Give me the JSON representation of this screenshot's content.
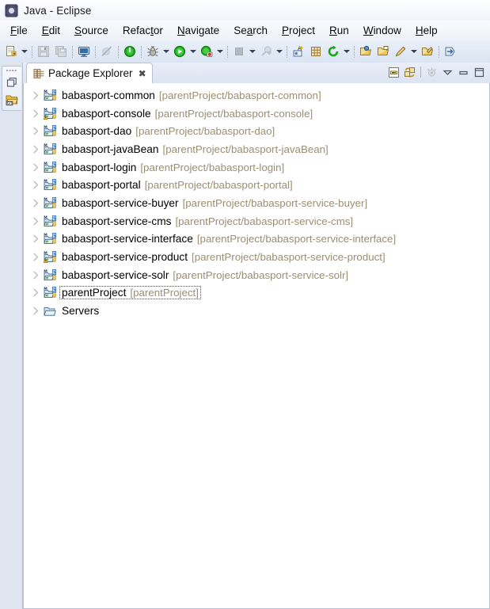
{
  "window": {
    "title": "Java - Eclipse",
    "icon": "eclipse-icon"
  },
  "menubar": {
    "items": [
      {
        "label": "File",
        "mnemonic": "F"
      },
      {
        "label": "Edit",
        "mnemonic": "E"
      },
      {
        "label": "Source",
        "mnemonic": "S"
      },
      {
        "label": "Refactor",
        "mnemonic": "t"
      },
      {
        "label": "Navigate",
        "mnemonic": "N"
      },
      {
        "label": "Search",
        "mnemonic": "a"
      },
      {
        "label": "Project",
        "mnemonic": "P"
      },
      {
        "label": "Run",
        "mnemonic": "R"
      },
      {
        "label": "Window",
        "mnemonic": "W"
      },
      {
        "label": "Help",
        "mnemonic": "H"
      }
    ]
  },
  "toolbar": {
    "items": [
      {
        "name": "new-wizard-button",
        "icon": "new-file-icon",
        "enabled": true,
        "dropdown": true
      },
      {
        "separator": true
      },
      {
        "name": "save-button",
        "icon": "save-icon",
        "enabled": false,
        "dropdown": false
      },
      {
        "name": "save-all-button",
        "icon": "save-all-icon",
        "enabled": false,
        "dropdown": false
      },
      {
        "separator": true
      },
      {
        "name": "open-console-button",
        "icon": "console-icon",
        "enabled": true,
        "dropdown": false
      },
      {
        "separator": true
      },
      {
        "name": "skip-breakpoints-button",
        "icon": "skip-breakpoints-icon",
        "enabled": false,
        "dropdown": false
      },
      {
        "separator": true
      },
      {
        "name": "run-server-button",
        "icon": "server-start-icon",
        "enabled": true,
        "dropdown": false
      },
      {
        "separator": true
      },
      {
        "name": "debug-button",
        "icon": "debug-bug-icon",
        "enabled": true,
        "dropdown": true
      },
      {
        "name": "run-button",
        "icon": "run-play-icon",
        "enabled": true,
        "dropdown": true
      },
      {
        "name": "coverage-button",
        "icon": "coverage-icon",
        "enabled": true,
        "dropdown": true
      },
      {
        "separator": true
      },
      {
        "name": "stop-button",
        "icon": "stop-square-icon",
        "enabled": false,
        "dropdown": true
      },
      {
        "name": "external-tools-button",
        "icon": "external-tools-icon",
        "enabled": false,
        "dropdown": true
      },
      {
        "separator": true
      },
      {
        "name": "new-java-class-button",
        "icon": "new-class-icon",
        "enabled": true,
        "dropdown": false
      },
      {
        "name": "new-java-package-button",
        "icon": "new-package-icon",
        "enabled": true,
        "dropdown": false
      },
      {
        "name": "refresh-button",
        "icon": "refresh-icon",
        "enabled": true,
        "dropdown": true
      },
      {
        "separator": true
      },
      {
        "name": "open-type-button",
        "icon": "open-type-icon",
        "enabled": true,
        "dropdown": false
      },
      {
        "name": "open-task-button",
        "icon": "open-task-icon",
        "enabled": true,
        "dropdown": false
      },
      {
        "name": "search-button",
        "icon": "search-pen-icon",
        "enabled": true,
        "dropdown": true
      },
      {
        "name": "last-edit-button",
        "icon": "last-edit-icon",
        "enabled": true,
        "dropdown": false
      },
      {
        "separator": true
      },
      {
        "name": "next-annotation-button",
        "icon": "next-annotation-icon",
        "enabled": true,
        "dropdown": false
      }
    ]
  },
  "fastview": {
    "buttons": [
      {
        "name": "restore-view-button",
        "icon": "restore-icon"
      },
      {
        "name": "git-repositories-button",
        "icon": "git-repositories-icon"
      }
    ]
  },
  "view": {
    "tab": {
      "label": "Package Explorer",
      "icon": "package-explorer-icon",
      "close": "✖"
    },
    "tools": [
      {
        "name": "collapse-all-button",
        "icon": "collapse-all-icon",
        "enabled": true
      },
      {
        "name": "link-with-editor-button",
        "icon": "link-editor-icon",
        "enabled": true
      },
      {
        "name": "focus-on-active-task-button",
        "icon": "focus-task-icon",
        "enabled": false
      },
      {
        "name": "view-menu-button",
        "icon": "chevron-down-icon",
        "enabled": true
      },
      {
        "name": "minimize-view-button",
        "icon": "minimize-icon",
        "enabled": true
      },
      {
        "name": "maximize-view-button",
        "icon": "maximize-icon",
        "enabled": true
      }
    ]
  },
  "tree": {
    "items": [
      {
        "name": "babasport-common",
        "path": "[parentProject/babasport-common]",
        "icon": "maven-java-project-icon",
        "expanded": false,
        "focused": false
      },
      {
        "name": "babasport-console",
        "path": "[parentProject/babasport-console]",
        "icon": "maven-java-project-warning-icon",
        "expanded": false,
        "focused": false
      },
      {
        "name": "babasport-dao",
        "path": "[parentProject/babasport-dao]",
        "icon": "maven-java-project-icon",
        "expanded": false,
        "focused": false
      },
      {
        "name": "babasport-javaBean",
        "path": "[parentProject/babasport-javaBean]",
        "icon": "maven-java-project-icon",
        "expanded": false,
        "focused": false
      },
      {
        "name": "babasport-login",
        "path": "[parentProject/babasport-login]",
        "icon": "maven-java-project-icon",
        "expanded": false,
        "focused": false
      },
      {
        "name": "babasport-portal",
        "path": "[parentProject/babasport-portal]",
        "icon": "maven-java-project-icon",
        "expanded": false,
        "focused": false
      },
      {
        "name": "babasport-service-buyer",
        "path": "[parentProject/babasport-service-buyer]",
        "icon": "maven-java-project-icon",
        "expanded": false,
        "focused": false
      },
      {
        "name": "babasport-service-cms",
        "path": "[parentProject/babasport-service-cms]",
        "icon": "maven-java-project-icon",
        "expanded": false,
        "focused": false
      },
      {
        "name": "babasport-service-interface",
        "path": "[parentProject/babasport-service-interface]",
        "icon": "maven-java-project-icon",
        "expanded": false,
        "focused": false
      },
      {
        "name": "babasport-service-product",
        "path": "[parentProject/babasport-service-product]",
        "icon": "maven-java-project-warning-icon",
        "expanded": false,
        "focused": false
      },
      {
        "name": "babasport-service-solr",
        "path": "[parentProject/babasport-service-solr]",
        "icon": "maven-java-project-icon",
        "expanded": false,
        "focused": false
      },
      {
        "name": "parentProject",
        "path": "[parentProject]",
        "icon": "maven-java-project-icon",
        "expanded": false,
        "focused": true
      },
      {
        "name": "Servers",
        "path": "",
        "icon": "folder-icon",
        "expanded": false,
        "focused": false
      }
    ]
  },
  "colors": {
    "project_name": "#000000",
    "project_path": "#9a8f72",
    "tree_background": "#ffffff",
    "chrome": "#dbe4f2",
    "fastbar": "#dfe4f1"
  }
}
